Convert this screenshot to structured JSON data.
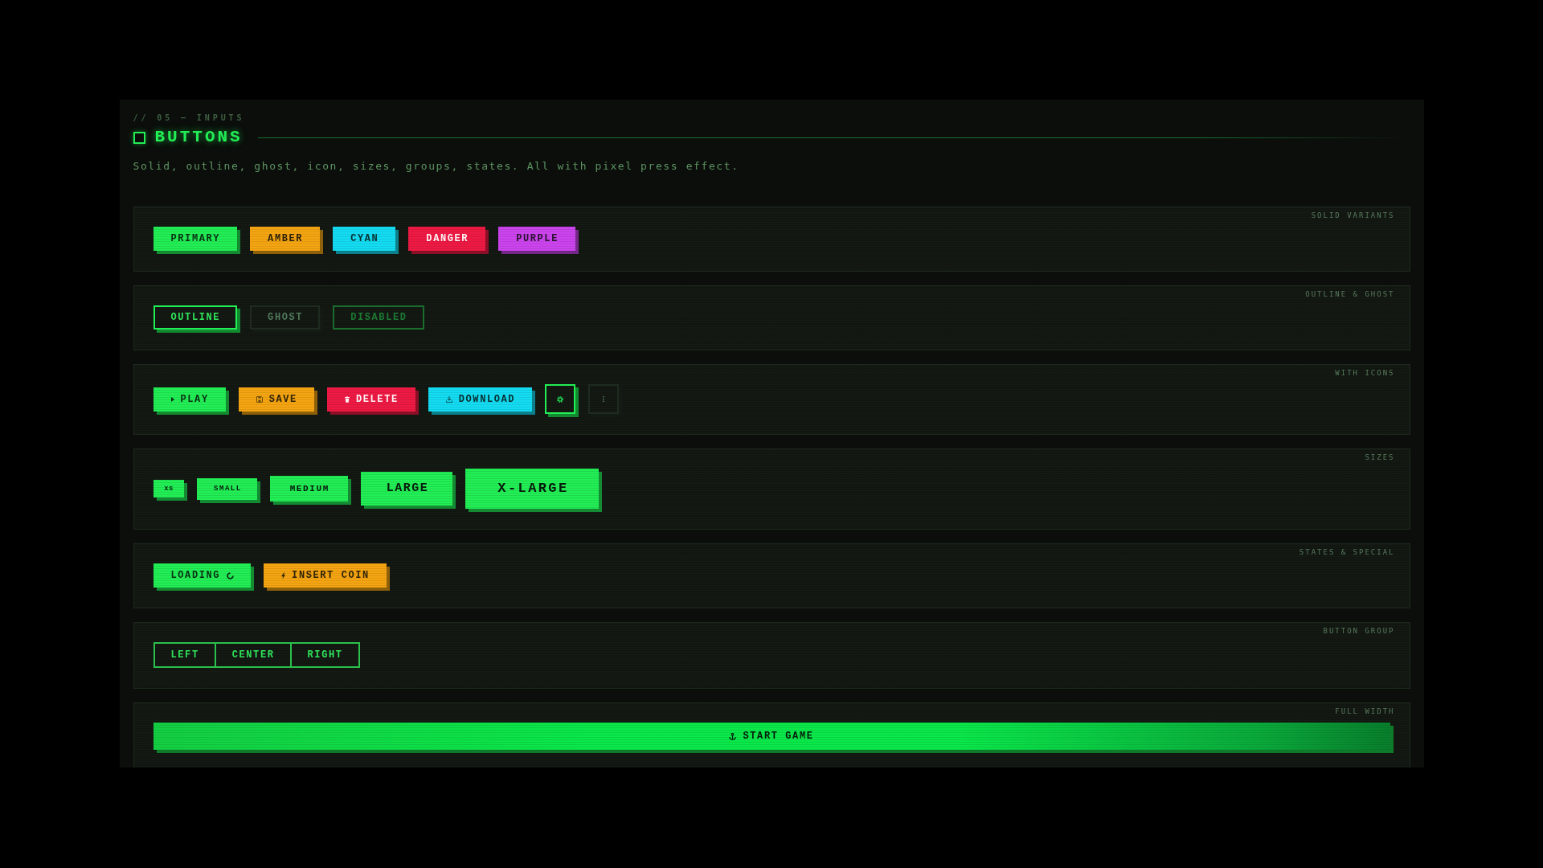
{
  "header": {
    "eyebrow": "// 05 — INPUTS",
    "title": "BUTTONS",
    "description": "Solid, outline, ghost, icon, sizes, groups, states. All with pixel press effect."
  },
  "sections": [
    {
      "kind": "row",
      "title": "SOLID VARIANTS",
      "buttons": [
        {
          "kind": "solid",
          "label": "PRIMARY",
          "color": "#22ee55"
        },
        {
          "kind": "solid",
          "label": "AMBER",
          "color": "#f5a512"
        },
        {
          "kind": "solid",
          "label": "CYAN",
          "color": "#14dcf2"
        },
        {
          "kind": "solid",
          "label": "DANGER",
          "color": "#ee1a44"
        },
        {
          "kind": "solid",
          "label": "PURPLE",
          "color": "#cc44ee"
        }
      ]
    },
    {
      "kind": "row",
      "title": "OUTLINE & GHOST",
      "buttons": [
        {
          "kind": "outline",
          "label": "OUTLINE",
          "disabled": false
        },
        {
          "kind": "ghost",
          "label": "GHOST",
          "disabled": false
        },
        {
          "kind": "outline",
          "label": "DISABLED",
          "disabled": true
        }
      ]
    },
    {
      "kind": "icons",
      "title": "WITH ICONS",
      "buttons": [
        {
          "kind": "solid",
          "label": "PLAY",
          "color": "#22ee55"
        },
        {
          "kind": "solid",
          "label": "SAVE",
          "color": "#f5a512"
        },
        {
          "kind": "solid",
          "label": "DELETE",
          "color": "#ee1a44"
        },
        {
          "kind": "solid",
          "label": "DOWNLOAD",
          "color": "#14dcf2"
        },
        {
          "kind": "outline"
        },
        {
          "kind": "ghost"
        }
      ]
    },
    {
      "kind": "sizes",
      "title": "SIZES",
      "buttons": [
        {
          "kind": "solid",
          "label": "XS"
        },
        {
          "kind": "solid",
          "label": "SMALL"
        },
        {
          "kind": "solid",
          "label": "MEDIUM"
        },
        {
          "kind": "solid",
          "label": "LARGE"
        },
        {
          "kind": "solid",
          "label": "X-LARGE"
        }
      ]
    },
    {
      "kind": "states",
      "title": "STATES & SPECIAL",
      "buttons": [
        {
          "kind": "solid",
          "label": "LOADING",
          "color": "#22ee55",
          "loading": true
        },
        {
          "kind": "solid",
          "label": "INSERT COIN",
          "color": "#f5a512",
          "loading": false
        }
      ]
    },
    {
      "kind": "group",
      "title": "BUTTON GROUP",
      "buttons": [
        {
          "label": "LEFT"
        },
        {
          "label": "CENTER"
        },
        {
          "label": "RIGHT"
        }
      ]
    },
    {
      "kind": "full",
      "title": "FULL WIDTH",
      "buttons": [
        {
          "label": "START GAME"
        }
      ]
    }
  ]
}
